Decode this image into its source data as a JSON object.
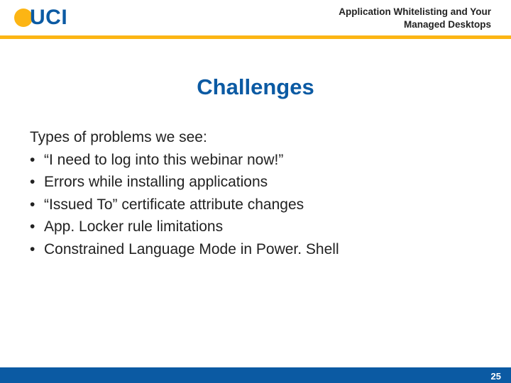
{
  "logo": {
    "text": "UCI"
  },
  "header": {
    "line1": "Application Whitelisting and Your",
    "line2": "Managed Desktops"
  },
  "title": "Challenges",
  "lead": "Types of problems we see:",
  "bullets": [
    "“I need to log into this webinar now!”",
    "Errors while installing applications",
    "“Issued To” certificate attribute changes",
    "App. Locker rule limitations",
    "Constrained Language Mode in Power. Shell"
  ],
  "page": "25"
}
